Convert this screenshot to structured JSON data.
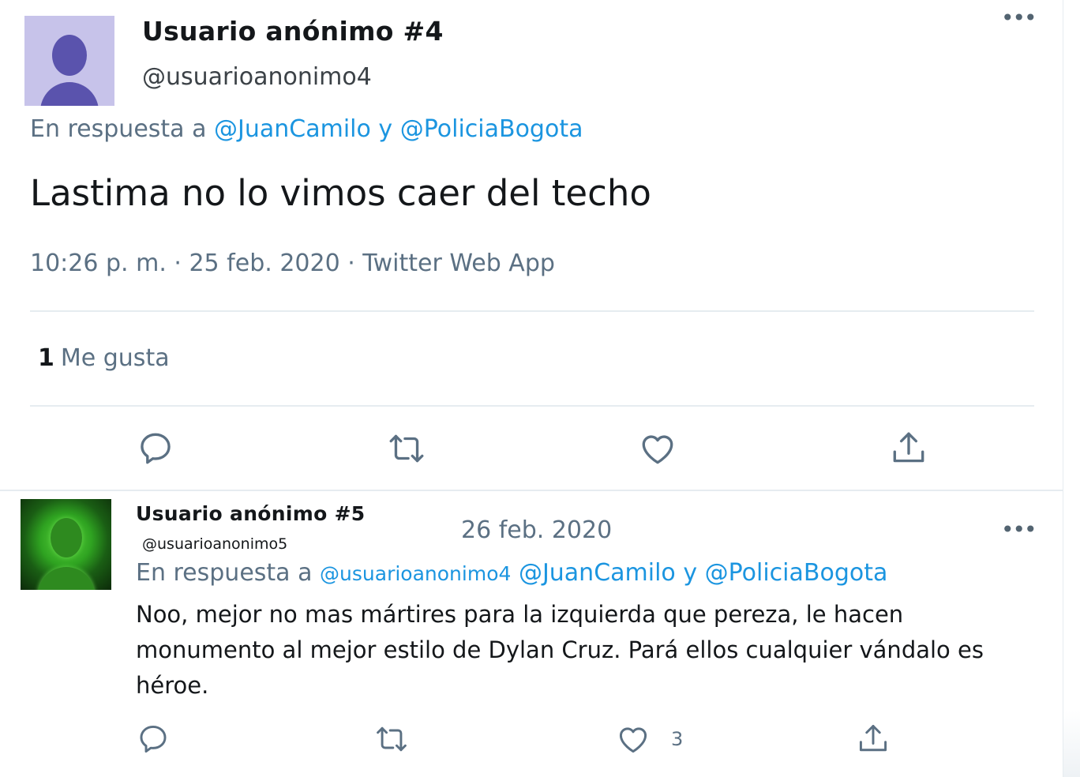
{
  "tweet_main": {
    "display_name": "Usuario anónimo #4",
    "handle": "@usuarioanonimo4",
    "reply_prefix": "En respuesta a",
    "reply_to_1": "@JuanCamilo",
    "reply_joiner": "y",
    "reply_to_2": "@PoliciaBogota",
    "text": "Lastima no lo vimos caer del techo",
    "meta": "10:26 p. m. · 25 feb. 2020 · Twitter Web App",
    "likes_count": "1",
    "likes_label": "Me gusta",
    "more_label": "•••"
  },
  "tweet_reply": {
    "display_name": "Usuario anónimo #5",
    "handle": "@usuarioanonimo5",
    "date": "26 feb. 2020",
    "reply_prefix": "En respuesta a",
    "reply_to_1": "@usuarioanonimo4",
    "reply_to_2": "@JuanCamilo",
    "reply_joiner": "y",
    "reply_to_3": "@PoliciaBogota",
    "text": "Noo, mejor no mas mártires para la izquierda que pereza, le hacen monumento al mejor estilo de Dylan Cruz. Pará ellos cualquier vándalo es héroe.",
    "like_count": "3",
    "more_label": "•••"
  },
  "icons": [
    "reply-icon",
    "retweet-icon",
    "like-icon",
    "share-icon",
    "more-icon",
    "avatar"
  ],
  "colors": {
    "link": "#1b95e0",
    "secondary_text": "#5b7083",
    "primary_text": "#14171a",
    "divider": "#e6ecf0",
    "avatar4_bg": "#c7c3ea",
    "avatar4_fg": "#5a53ad",
    "avatar5_fg": "#2e8a1f"
  }
}
